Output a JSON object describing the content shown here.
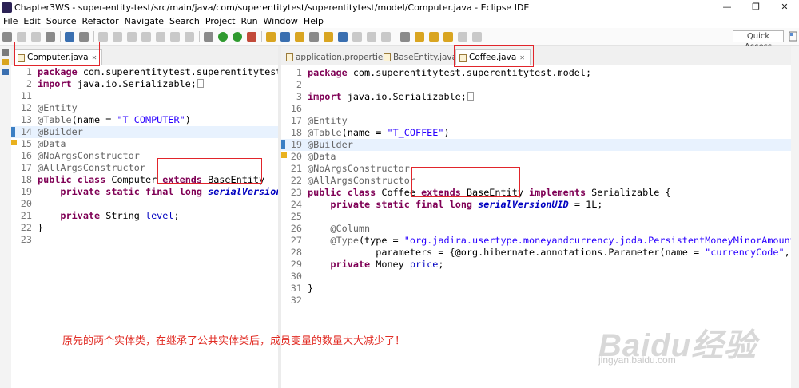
{
  "window": {
    "title": "Chapter3WS - super-entity-test/src/main/java/com/superentitytest/superentitytest/model/Computer.java - Eclipse IDE",
    "minimize": "—",
    "maximize": "❐",
    "close": "✕"
  },
  "menu": [
    "File",
    "Edit",
    "Source",
    "Refactor",
    "Navigate",
    "Search",
    "Project",
    "Run",
    "Window",
    "Help"
  ],
  "toolbar": {
    "quick_access": "Quick Access"
  },
  "left_editor": {
    "tabs": [
      {
        "label": "Computer.java",
        "close": "✕"
      }
    ],
    "lines": [
      {
        "n": "1",
        "t": [
          [
            "kw",
            "package"
          ],
          [
            "p",
            " com.superentitytest.superentitytest.model;"
          ]
        ]
      },
      {
        "n": "2",
        "t": [
          [
            "kw",
            "import"
          ],
          [
            "p",
            " java.io.Serializable;"
          ],
          [
            "fold",
            ""
          ]
        ]
      },
      {
        "n": "11",
        "t": []
      },
      {
        "n": "12",
        "t": [
          [
            "an",
            "@Entity"
          ]
        ]
      },
      {
        "n": "13",
        "t": [
          [
            "an",
            "@Table"
          ],
          [
            "p",
            "(name = "
          ],
          [
            "str",
            "\"T_COMPUTER\""
          ],
          [
            "p",
            ")"
          ]
        ]
      },
      {
        "n": "14",
        "t": [
          [
            "an",
            "@Builder"
          ]
        ]
      },
      {
        "n": "15",
        "t": [
          [
            "an",
            "@Data"
          ]
        ]
      },
      {
        "n": "16",
        "t": [
          [
            "an",
            "@NoArgsConstructor"
          ]
        ]
      },
      {
        "n": "17",
        "t": [
          [
            "an",
            "@AllArgsConstructor"
          ]
        ]
      },
      {
        "n": "18",
        "t": [
          [
            "kw",
            "public"
          ],
          [
            "p",
            " "
          ],
          [
            "kw",
            "class"
          ],
          [
            "p",
            " Computer "
          ],
          [
            "kw",
            "extends"
          ],
          [
            "p",
            " BaseEntity"
          ]
        ]
      },
      {
        "n": "19",
        "t": [
          [
            "p",
            "    "
          ],
          [
            "kw",
            "private"
          ],
          [
            "p",
            " "
          ],
          [
            "kw",
            "static"
          ],
          [
            "p",
            " "
          ],
          [
            "kw",
            "final"
          ],
          [
            "p",
            " "
          ],
          [
            "kw",
            "long"
          ],
          [
            "p",
            " "
          ],
          [
            "sfld",
            "serialVersionUID"
          ]
        ]
      },
      {
        "n": "20",
        "t": []
      },
      {
        "n": "21",
        "t": [
          [
            "p",
            "    "
          ],
          [
            "kw",
            "private"
          ],
          [
            "p",
            " String "
          ],
          [
            "fld",
            "level"
          ],
          [
            "p",
            ";"
          ]
        ]
      },
      {
        "n": "22",
        "t": [
          [
            "p",
            "}"
          ]
        ]
      },
      {
        "n": "23",
        "t": []
      }
    ]
  },
  "right_editor": {
    "tabs": [
      {
        "label": "application.properties"
      },
      {
        "label": "BaseEntity.java"
      },
      {
        "label": "Coffee.java",
        "close": "✕"
      }
    ],
    "lines": [
      {
        "n": "1",
        "t": [
          [
            "kw",
            "package"
          ],
          [
            "p",
            " com.superentitytest.superentitytest.model;"
          ]
        ]
      },
      {
        "n": "2",
        "t": []
      },
      {
        "n": "3",
        "fold": "⊕",
        "t": [
          [
            "kw",
            "import"
          ],
          [
            "p",
            " java.io.Serializable;"
          ],
          [
            "fold",
            ""
          ]
        ]
      },
      {
        "n": "16",
        "t": []
      },
      {
        "n": "17",
        "t": [
          [
            "an",
            "@Entity"
          ]
        ]
      },
      {
        "n": "18",
        "t": [
          [
            "an",
            "@Table"
          ],
          [
            "p",
            "(name = "
          ],
          [
            "str",
            "\"T_COFFEE\""
          ],
          [
            "p",
            ")"
          ]
        ]
      },
      {
        "n": "19",
        "t": [
          [
            "an",
            "@Builder"
          ]
        ]
      },
      {
        "n": "20",
        "t": [
          [
            "an",
            "@Data"
          ]
        ]
      },
      {
        "n": "21",
        "t": [
          [
            "an",
            "@NoArgsConstructor"
          ]
        ]
      },
      {
        "n": "22",
        "t": [
          [
            "an",
            "@AllArgsConstructor"
          ]
        ]
      },
      {
        "n": "23",
        "t": [
          [
            "kw",
            "public"
          ],
          [
            "p",
            " "
          ],
          [
            "kw",
            "class"
          ],
          [
            "p",
            " Coffee "
          ],
          [
            "kw",
            "extends"
          ],
          [
            "p",
            " BaseEntity "
          ],
          [
            "kw",
            "implements"
          ],
          [
            "p",
            " Serializable {"
          ]
        ]
      },
      {
        "n": "24",
        "t": [
          [
            "p",
            "    "
          ],
          [
            "kw",
            "private"
          ],
          [
            "p",
            " "
          ],
          [
            "kw",
            "static"
          ],
          [
            "p",
            " "
          ],
          [
            "kw",
            "final"
          ],
          [
            "p",
            " "
          ],
          [
            "kw",
            "long"
          ],
          [
            "p",
            " "
          ],
          [
            "sfld",
            "serialVersionUID"
          ],
          [
            "p",
            " = 1L;"
          ]
        ]
      },
      {
        "n": "25",
        "t": []
      },
      {
        "n": "26",
        "fold": "⊖",
        "t": [
          [
            "p",
            "    "
          ],
          [
            "an",
            "@Column"
          ]
        ]
      },
      {
        "n": "27",
        "t": [
          [
            "p",
            "    "
          ],
          [
            "an",
            "@Type"
          ],
          [
            "p",
            "(type = "
          ],
          [
            "str",
            "\"org.jadira.usertype.moneyandcurrency.joda.PersistentMoneyMinorAmount\""
          ],
          [
            "p",
            ","
          ]
        ]
      },
      {
        "n": "28",
        "t": [
          [
            "p",
            "            parameters = {@org.hibernate.annotations.Parameter(name = "
          ],
          [
            "str",
            "\"currencyCode\""
          ],
          [
            "p",
            ", value"
          ]
        ]
      },
      {
        "n": "29",
        "t": [
          [
            "p",
            "    "
          ],
          [
            "kw",
            "private"
          ],
          [
            "p",
            " Money "
          ],
          [
            "fld",
            "price"
          ],
          [
            "p",
            ";"
          ]
        ]
      },
      {
        "n": "30",
        "t": []
      },
      {
        "n": "31",
        "t": [
          [
            "p",
            "}"
          ]
        ]
      },
      {
        "n": "32",
        "t": []
      }
    ]
  },
  "annotation_caption": "原先的两个实体类，在继承了公共实体类后，成员变量的数量大大减少了！",
  "watermark": {
    "main": "Baidu经验",
    "sub": "jingyan.baidu.com"
  },
  "colors": {
    "keyword": "#7f0055",
    "annotation": "#646464",
    "string": "#2a00ff",
    "field": "#0000c0",
    "highlight_box": "#e1252b",
    "caption": "#e12c24"
  }
}
